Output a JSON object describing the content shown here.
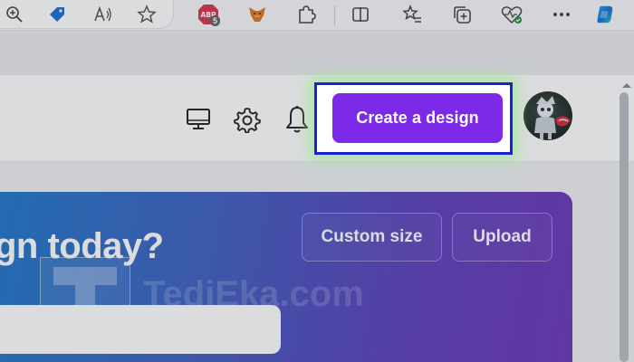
{
  "browser": {
    "toolbar_icons": [
      "zoom-icon",
      "tag-icon",
      "read-aloud-icon",
      "favorite-star-icon",
      "adblock-plus-icon",
      "metamask-fox-icon",
      "extensions-puzzle-icon",
      "split-screen-icon",
      "favorites-list-icon",
      "collections-icon",
      "browser-health-icon",
      "more-icon",
      "copilot-icon"
    ],
    "adblock_badge_count": "5",
    "adblock_label": "ABP"
  },
  "header": {
    "icons": [
      "desktop-icon",
      "settings-gear-icon",
      "notifications-bell-icon"
    ],
    "create_button_label": "Create a design",
    "avatar": "user-avatar"
  },
  "hero": {
    "title": "gn today?",
    "custom_size_label": "Custom size",
    "upload_label": "Upload",
    "search_placeholder": ""
  },
  "watermark": {
    "text": "TediEka.com",
    "logo_letter": "T"
  },
  "colors": {
    "create_button": "#7d2ae8",
    "highlight_border": "#1a21d9",
    "highlight_glow": "#a0eb96",
    "hero_gradient_start": "#1f77c9",
    "hero_gradient_end": "#6a35b8"
  }
}
